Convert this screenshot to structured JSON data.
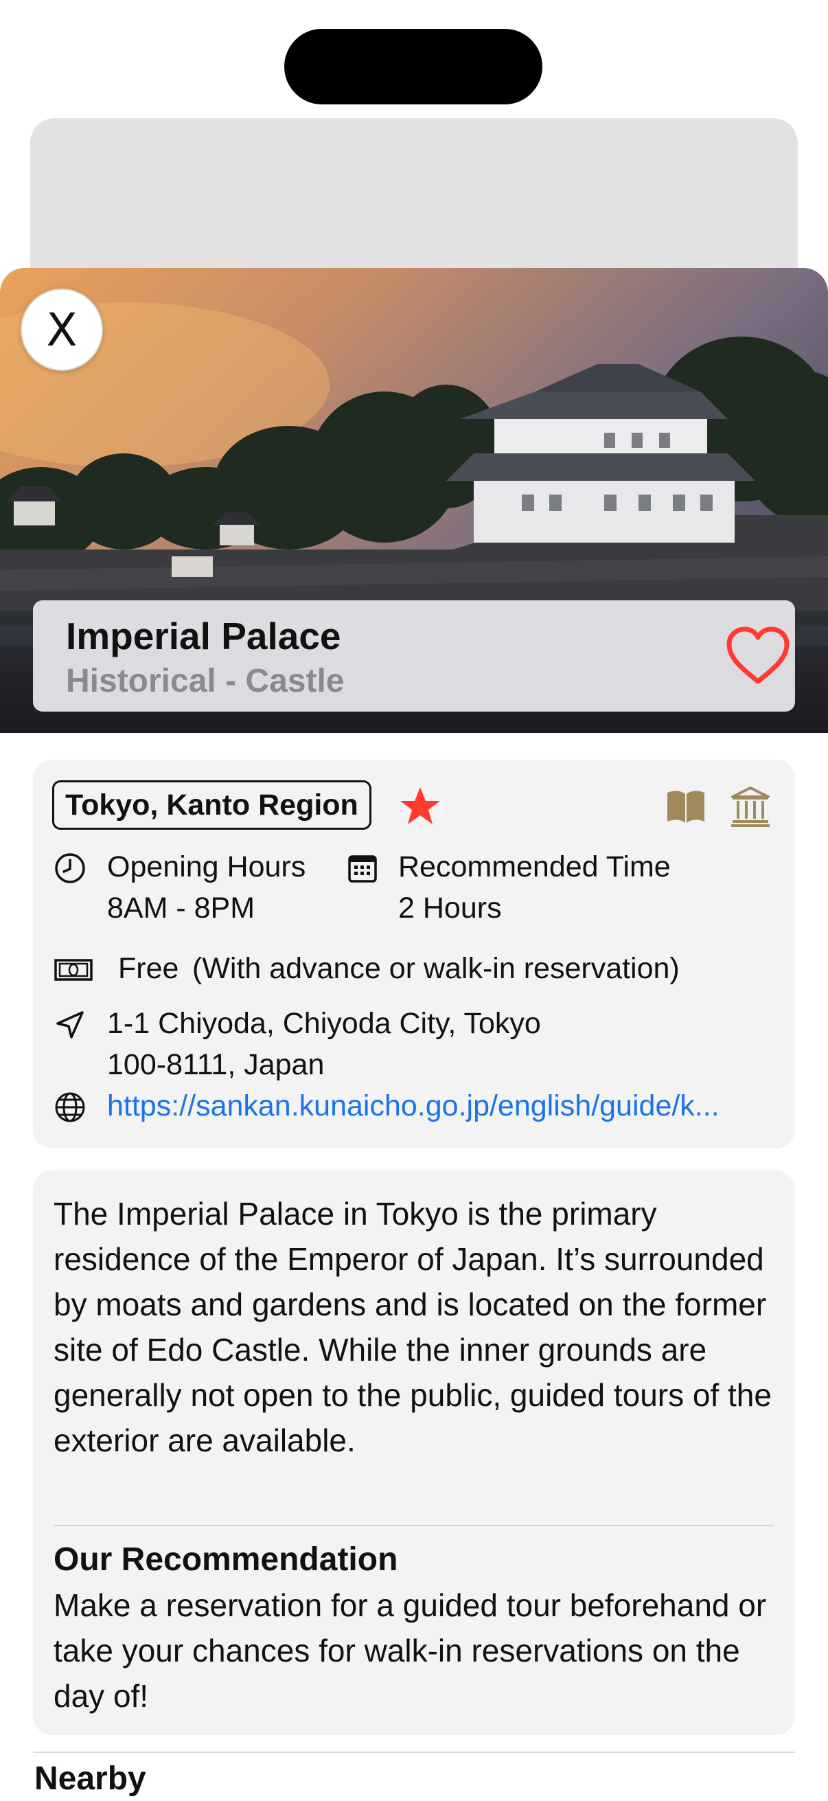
{
  "header": {
    "close_label": "X"
  },
  "place": {
    "name": "Imperial Palace",
    "category": "Historical - Castle",
    "favorite": true
  },
  "info": {
    "region": "Tokyo, Kanto Region",
    "opening_hours_label": "Opening Hours",
    "opening_hours_value": "8AM - 8PM",
    "recommended_time_label": "Recommended Time",
    "recommended_time_value": "2 Hours",
    "price": "Free",
    "price_note": "(With advance or walk-in reservation)",
    "address_line1": "1-1 Chiyoda, Chiyoda City, Tokyo",
    "address_line2": "100-8111, Japan",
    "website": "https://sankan.kunaicho.go.jp/english/guide/k..."
  },
  "description": {
    "text": "The Imperial Palace in Tokyo is the primary residence of the Emperor of Japan. It’s surrounded by moats and gardens and is located on the former site of Edo Castle. While the inner grounds are generally not open to the public, guided tours of the exterior are available.",
    "recommendation_title": "Our Recommendation",
    "recommendation_text": "Make a reservation for a guided tour beforehand or take your chances for walk-in reservations on the day of!"
  },
  "nearby": {
    "title": "Nearby"
  },
  "colors": {
    "accent_red": "#ff3b30",
    "link_blue": "#1a73e8",
    "icon_gold": "#a08a5c",
    "card_bg": "#f3f3f3"
  },
  "icons": [
    "close-icon",
    "heart-icon",
    "star-icon",
    "book-icon",
    "museum-icon",
    "clock-icon",
    "calendar-icon",
    "money-icon",
    "location-arrow-icon",
    "globe-icon"
  ]
}
